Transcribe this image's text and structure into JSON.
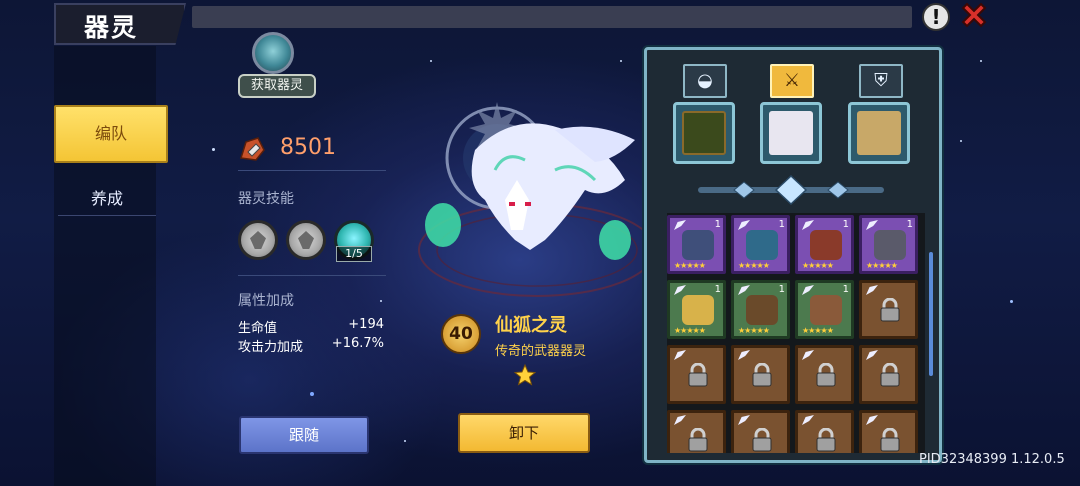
{
  "header": {
    "title": "器灵",
    "info_icon": "info-icon",
    "close_icon": "close-icon"
  },
  "sidebar": {
    "items": [
      {
        "label": "编队",
        "active": true
      },
      {
        "label": "养成",
        "active": false
      }
    ]
  },
  "get_spirit": {
    "label": "获取器灵"
  },
  "stats": {
    "power_value": "8501",
    "skills_title": "器灵技能",
    "skills": [
      {
        "icon": "gray-skill-icon"
      },
      {
        "icon": "gray-skill-icon"
      },
      {
        "icon": "teal-orb-skill-icon",
        "count": "1/5"
      }
    ],
    "attr_title": "属性加成",
    "attributes": [
      {
        "name": "生命值",
        "value": "+194"
      },
      {
        "name": "攻击力加成",
        "value": "+16.7%"
      }
    ]
  },
  "spirit": {
    "level": "40",
    "name": "仙狐之灵",
    "description": "传奇的武器器灵",
    "stars": 1
  },
  "buttons": {
    "follow": "跟随",
    "unequip": "卸下"
  },
  "equip_tabs": [
    {
      "icon": "armor-icon"
    },
    {
      "icon": "sword-icon",
      "active": true
    },
    {
      "icon": "shield-icon"
    }
  ],
  "inventory": {
    "rows": [
      [
        {
          "rarity": "purple",
          "count": "1",
          "locked": false
        },
        {
          "rarity": "purple",
          "count": "1",
          "locked": false
        },
        {
          "rarity": "purple",
          "count": "1",
          "locked": false
        },
        {
          "rarity": "purple",
          "count": "1",
          "locked": false
        }
      ],
      [
        {
          "rarity": "green",
          "count": "1",
          "locked": false
        },
        {
          "rarity": "green",
          "count": "1",
          "locked": false
        },
        {
          "rarity": "green",
          "count": "1",
          "locked": false
        },
        {
          "rarity": "brown",
          "locked": true
        }
      ],
      [
        {
          "rarity": "brown",
          "locked": true
        },
        {
          "rarity": "brown",
          "locked": true
        },
        {
          "rarity": "brown",
          "locked": true
        },
        {
          "rarity": "brown",
          "locked": true
        }
      ],
      [
        {
          "rarity": "brown",
          "locked": true
        },
        {
          "rarity": "brown",
          "locked": true
        },
        {
          "rarity": "brown",
          "locked": true
        },
        {
          "rarity": "brown",
          "locked": true
        }
      ]
    ]
  },
  "version": "PID32348399 1.12.0.5",
  "colors": {
    "accent_yellow": "#f4c535",
    "gold_text": "#ffd24a",
    "power_text": "#ff9f6b",
    "panel_border": "#7fb4c6"
  }
}
